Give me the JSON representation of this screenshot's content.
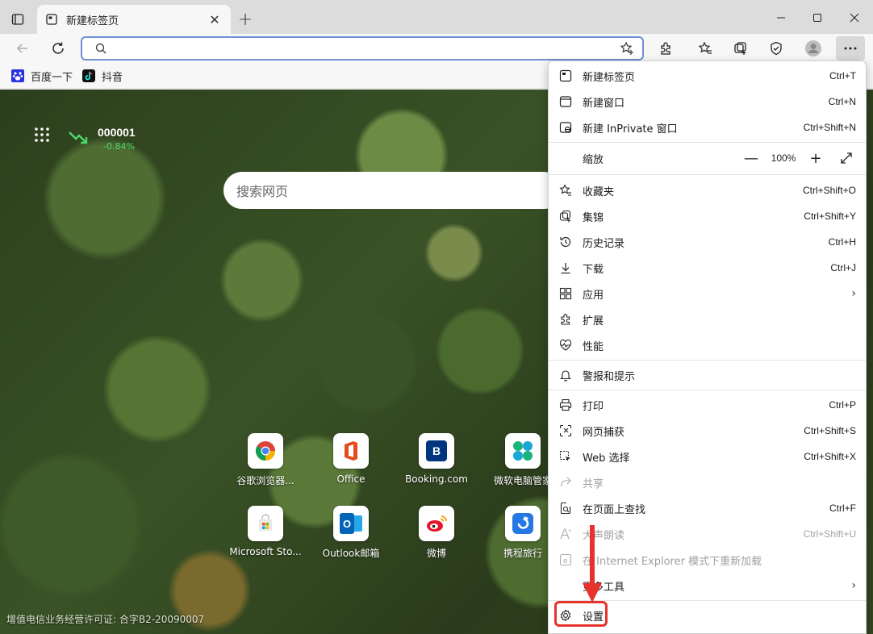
{
  "tab": {
    "title": "新建标签页",
    "close": "✕"
  },
  "new_tab": "+",
  "address": {
    "value": "",
    "placeholder": ""
  },
  "bookmarks": [
    {
      "label": "百度一下",
      "icon": "baidu-paw-icon"
    },
    {
      "label": "抖音",
      "icon": "douyin-icon"
    }
  ],
  "stock": {
    "code": "000001",
    "change": "-0.84%"
  },
  "search": {
    "placeholder": "搜索网页"
  },
  "tiles": [
    {
      "label": "谷歌浏览器...",
      "icon": "chrome-icon"
    },
    {
      "label": "Office",
      "icon": "office-icon"
    },
    {
      "label": "Booking.com",
      "icon": "booking-icon",
      "letter": "B"
    },
    {
      "label": "微软电脑管家",
      "icon": "pc-manager-icon"
    },
    {
      "label": "Microsoft Sto...",
      "icon": "store-icon"
    },
    {
      "label": "Outlook邮箱",
      "icon": "outlook-icon",
      "letter": "O"
    },
    {
      "label": "微博",
      "icon": "weibo-icon"
    },
    {
      "label": "携程旅行",
      "icon": "ctrip-icon"
    }
  ],
  "license": "增值电信业务经营许可证: 合字B2-20090007",
  "menu": {
    "new_tab": {
      "label": "新建标签页",
      "shortcut": "Ctrl+T"
    },
    "new_window": {
      "label": "新建窗口",
      "shortcut": "Ctrl+N"
    },
    "new_inprivate": {
      "label": "新建 InPrivate 窗口",
      "shortcut": "Ctrl+Shift+N"
    },
    "zoom": {
      "label": "缩放",
      "minus": "—",
      "value": "100%",
      "plus": "+"
    },
    "favorites": {
      "label": "收藏夹",
      "shortcut": "Ctrl+Shift+O"
    },
    "collections": {
      "label": "集锦",
      "shortcut": "Ctrl+Shift+Y"
    },
    "history": {
      "label": "历史记录",
      "shortcut": "Ctrl+H"
    },
    "downloads": {
      "label": "下载",
      "shortcut": "Ctrl+J"
    },
    "apps": {
      "label": "应用",
      "chevron": "›"
    },
    "extensions": {
      "label": "扩展"
    },
    "performance": {
      "label": "性能"
    },
    "alerts": {
      "label": "警报和提示"
    },
    "print": {
      "label": "打印",
      "shortcut": "Ctrl+P"
    },
    "capture": {
      "label": "网页捕获",
      "shortcut": "Ctrl+Shift+S"
    },
    "web_select": {
      "label": "Web 选择",
      "shortcut": "Ctrl+Shift+X"
    },
    "share": {
      "label": "共享"
    },
    "find": {
      "label": "在页面上查找",
      "shortcut": "Ctrl+F"
    },
    "read_aloud": {
      "label": "大声朗读",
      "shortcut": "Ctrl+Shift+U"
    },
    "ie_mode": {
      "label": "在 Internet Explorer 模式下重新加载"
    },
    "more_tools": {
      "label": "更多工具",
      "chevron": "›"
    },
    "settings": {
      "label": "设置"
    }
  },
  "colors": {
    "accent": "#6f8fd1",
    "highlight": "#e8322d",
    "stock_down": "#4cd86a"
  }
}
